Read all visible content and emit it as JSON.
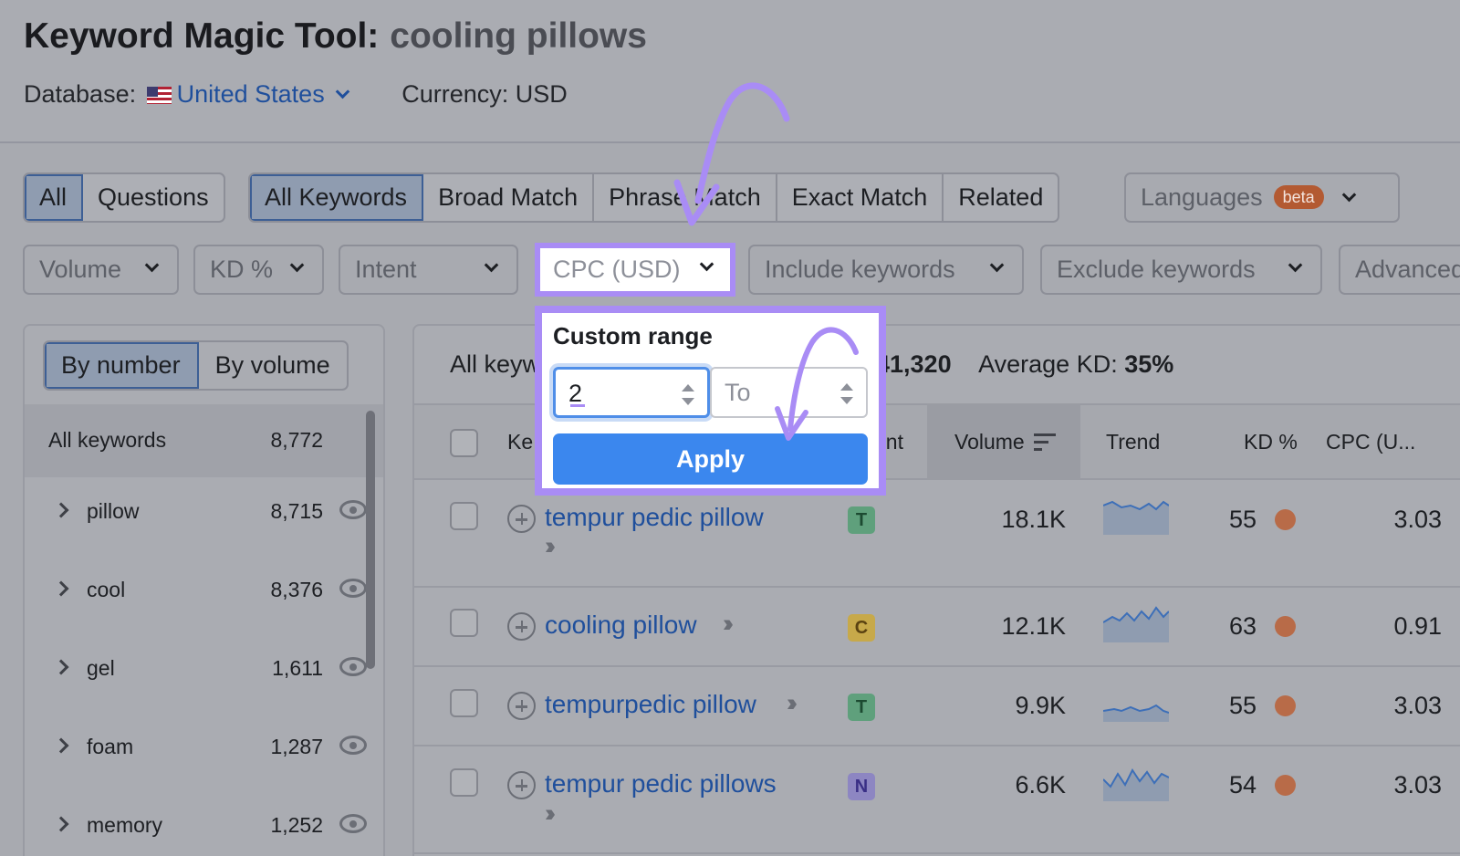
{
  "header": {
    "title": "Keyword Magic Tool:",
    "query": "cooling pillows",
    "database_label": "Database:",
    "database_value": "United States",
    "currency": "Currency: USD"
  },
  "tabs_scope": [
    "All",
    "Questions"
  ],
  "tabs_match": [
    "All Keywords",
    "Broad Match",
    "Phrase Match",
    "Exact Match",
    "Related"
  ],
  "languages": {
    "label": "Languages",
    "badge": "beta"
  },
  "filters": {
    "volume": "Volume",
    "kd": "KD %",
    "intent": "Intent",
    "cpc": "CPC (USD)",
    "include": "Include keywords",
    "exclude": "Exclude keywords",
    "advanced": "Advanced"
  },
  "popup": {
    "title": "Custom range",
    "from_value": "2",
    "to_placeholder": "To",
    "apply": "Apply"
  },
  "sidebar": {
    "toggle": [
      "By number",
      "By volume"
    ],
    "all_label": "All keywords",
    "all_count": "8,772",
    "items": [
      {
        "label": "pillow",
        "count": "8,715"
      },
      {
        "label": "cool",
        "count": "8,376"
      },
      {
        "label": "gel",
        "count": "1,611"
      },
      {
        "label": "foam",
        "count": "1,287"
      },
      {
        "label": "memory",
        "count": "1,252"
      }
    ]
  },
  "summary": {
    "all_prefix": "All keyw",
    "volume_partial": "41,320",
    "avg_kd_label": "Average KD:",
    "avg_kd_value": "35%"
  },
  "table": {
    "headers": {
      "keyword": "Ke",
      "intent": "ent",
      "volume": "Volume",
      "trend": "Trend",
      "kd": "KD %",
      "cpc": "CPC (U..."
    },
    "rows": [
      {
        "keyword": "tempur pedic pillow",
        "intent": "T",
        "volume": "18.1K",
        "kd": "55",
        "cpc": "3.03"
      },
      {
        "keyword": "cooling pillow",
        "intent": "C",
        "volume": "12.1K",
        "kd": "63",
        "cpc": "0.91"
      },
      {
        "keyword": "tempurpedic pillow",
        "intent": "T",
        "volume": "9.9K",
        "kd": "55",
        "cpc": "3.03"
      },
      {
        "keyword": "tempur pedic pillows",
        "intent": "N",
        "volume": "6.6K",
        "kd": "54",
        "cpc": "3.03"
      }
    ]
  },
  "colors": {
    "accent_purple": "#a98cf5",
    "apply_blue": "#3b87ee",
    "link_blue": "#1f4f9c",
    "kd_dot": "#b86b48"
  }
}
